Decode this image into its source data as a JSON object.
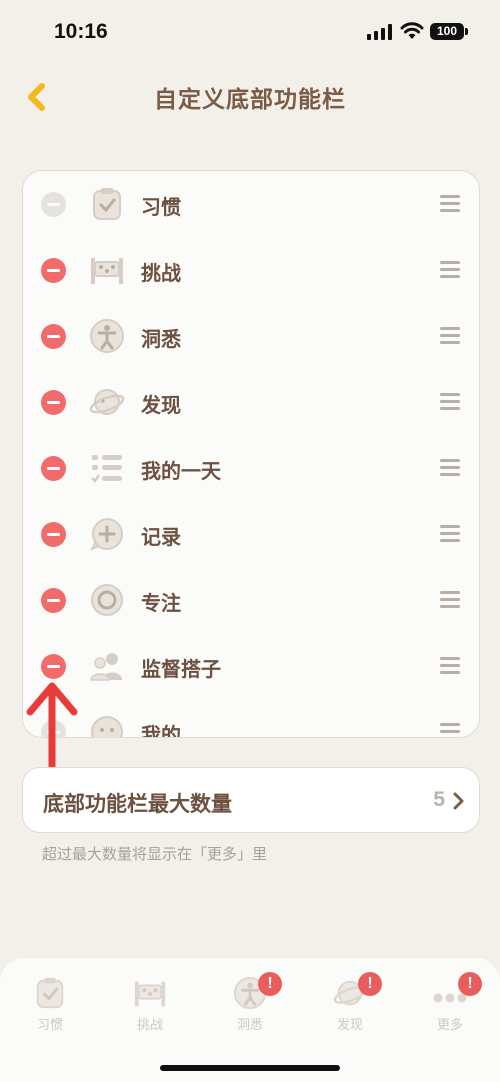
{
  "status": {
    "time": "10:16",
    "battery": "100"
  },
  "nav": {
    "title": "自定义底部功能栏"
  },
  "list": {
    "items": [
      {
        "label": "习惯",
        "icon": "habit-icon",
        "removable": false
      },
      {
        "label": "挑战",
        "icon": "challenge-icon",
        "removable": true
      },
      {
        "label": "洞悉",
        "icon": "insight-icon",
        "removable": true
      },
      {
        "label": "发现",
        "icon": "discover-icon",
        "removable": true
      },
      {
        "label": "我的一天",
        "icon": "my-day-icon",
        "removable": true
      },
      {
        "label": "记录",
        "icon": "record-icon",
        "removable": true
      },
      {
        "label": "专注",
        "icon": "focus-icon",
        "removable": true
      },
      {
        "label": "监督搭子",
        "icon": "buddy-icon",
        "removable": true
      },
      {
        "label": "我的",
        "icon": "profile-icon",
        "removable": true
      }
    ]
  },
  "max": {
    "label": "底部功能栏最大数量",
    "value": "5"
  },
  "hint": "超过最大数量将显示在「更多」里",
  "tabbar": {
    "tabs": [
      {
        "label": "习惯",
        "icon": "habit-icon",
        "badge": ""
      },
      {
        "label": "挑战",
        "icon": "challenge-icon",
        "badge": ""
      },
      {
        "label": "洞悉",
        "icon": "insight-icon",
        "badge": "!"
      },
      {
        "label": "发现",
        "icon": "discover-icon",
        "badge": "!"
      },
      {
        "label": "更多",
        "icon": "more-icon",
        "badge": "!"
      }
    ]
  },
  "colors": {
    "accent_red": "#f16b6b",
    "title_brown": "#7a5c45",
    "back_yellow": "#f3b81b",
    "background": "#f3efe9"
  }
}
